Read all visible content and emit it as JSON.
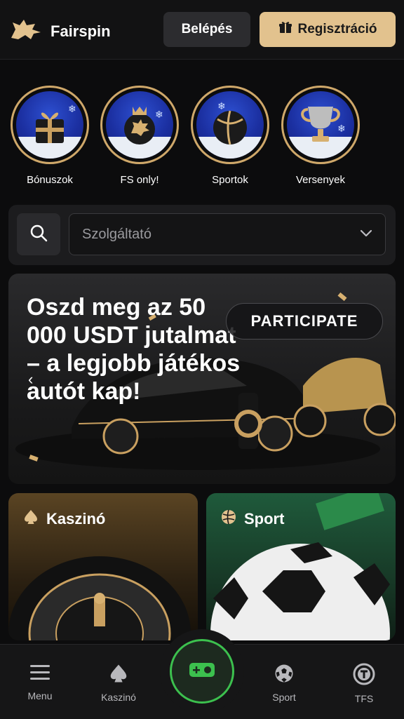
{
  "header": {
    "brand": "Fairspin",
    "login_label": "Belépés",
    "register_label": "Regisztráció",
    "register_icon": "gift-icon",
    "logo_icon": "lion-icon"
  },
  "stories": [
    {
      "label": "Bónuszok",
      "icon": "gift-box-icon"
    },
    {
      "label": "FS only!",
      "icon": "lion-crown-icon"
    },
    {
      "label": "Sportok",
      "icon": "ball-icon"
    },
    {
      "label": "Versenyek",
      "icon": "trophy-icon"
    }
  ],
  "search": {
    "icon": "search-icon",
    "provider_placeholder": "Szolgáltató",
    "dropdown_icon": "chevron-down-icon"
  },
  "banner": {
    "title": "Oszd meg az 50 000 USDT jutalmat – a legjobb játékos autót kap!",
    "cta_label": "PARTICIPATE",
    "arrow": "‹"
  },
  "categories": [
    {
      "title": "Kaszinó",
      "icon": "spade-icon"
    },
    {
      "title": "Sport",
      "icon": "volleyball-icon"
    }
  ],
  "bottom_nav": {
    "items": [
      {
        "label": "Menu",
        "icon": "menu-icon"
      },
      {
        "label": "Kaszinó",
        "icon": "spade-icon"
      },
      {
        "label": "Sport",
        "icon": "soccer-ball-icon"
      },
      {
        "label": "TFS",
        "icon": "tfs-token-icon"
      }
    ],
    "center_icon": "wallet-icon"
  },
  "colors": {
    "accent_gold": "#e2c28e",
    "ring_gold": "#cfa86a",
    "center_green": "#3cc04e",
    "background": "#0c0c0d"
  }
}
